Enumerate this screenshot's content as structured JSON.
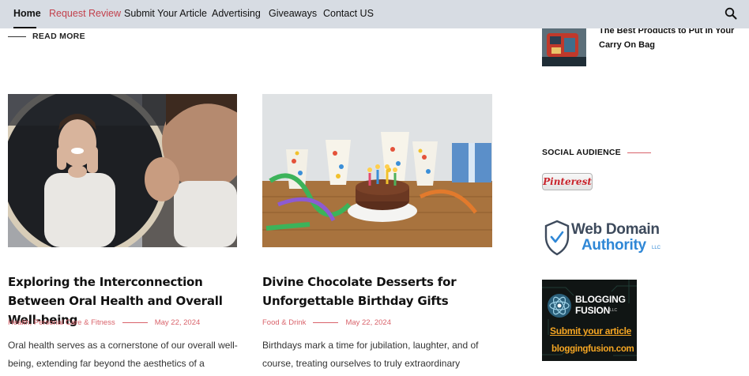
{
  "nav": {
    "items": [
      {
        "label": "Home"
      },
      {
        "label": "Request Review"
      },
      {
        "label": "Submit Your Article"
      },
      {
        "label": "Advertising"
      },
      {
        "label": "Giveaways"
      },
      {
        "label": "Contact US"
      }
    ],
    "search_icon": "search-icon"
  },
  "previous_post": {
    "read_more_label": "READ MORE"
  },
  "posts": [
    {
      "title": "Exploring the Interconnection Between Oral Health and Overall Well-being",
      "categories": "Health, Personal Care & Fitness",
      "date": "May 22, 2024",
      "excerpt": "Oral health serves as a cornerstone of our overall well-being, extending far beyond the aesthetics of a"
    },
    {
      "title": "Divine Chocolate Desserts for Unforgettable Birthday Gifts",
      "categories": "Food & Drink",
      "date": "May 22, 2024",
      "excerpt": "Birthdays mark a time for jubilation, laughter, and of course, treating ourselves to truly extraordinary"
    }
  ],
  "sidebar": {
    "recent_post_title": "The Best Products to Put In Your Carry On Bag",
    "social_heading": "SOCIAL AUDIENCE",
    "pinterest_label": "Pinterest",
    "wda": {
      "line1": "Web Domain",
      "line2": "Authority",
      "suffix": "LLC"
    },
    "blogging_fusion": {
      "name": "BLOGGING",
      "name2": "FUSION",
      "suffix": "LLC",
      "cta": "Submit your article",
      "url": "bloggingfusion.com"
    }
  },
  "colors": {
    "accent": "#d9636b",
    "nav_bg": "#d7dce3",
    "link_highlight": "#c2414c"
  }
}
